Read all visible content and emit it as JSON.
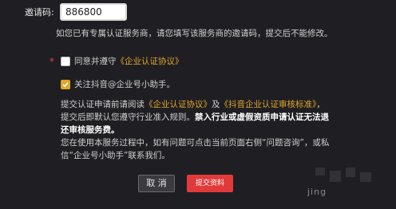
{
  "form": {
    "invite_label": "邀请码:",
    "invite_value": "886800",
    "invite_hint": "如您已有专属认证服务商，请您填写该服务商的邀请码，提交后不能修改。",
    "agree_prefix": "同意并遵守",
    "agree_link": "《企业认证协议》",
    "follow_label": "关注抖音@企业号小助手。",
    "notice": {
      "p1_a": "提交认证申请前请阅读",
      "p1_link1": "《企业认证协议》",
      "p1_b": "及",
      "p1_link2": "《抖音企业认证审核标准》",
      "p1_c": "，提交后即默认您遵守行业准入规则。",
      "p1_bold": "禁入行业或虚假资质申请认证无法退还审核服务费。",
      "p2": "您在使用本服务过程中，如有问题可点击当前页面右侧“问题咨询”，或私信“企业号小助手”联系我们。"
    },
    "cancel_label": "取 消",
    "submit_label": "提交资料"
  },
  "watermark": {
    "text": "jing"
  },
  "colors": {
    "accent": "#e0a52c",
    "submit": "#e23a3a",
    "background": "#1f1f23"
  }
}
